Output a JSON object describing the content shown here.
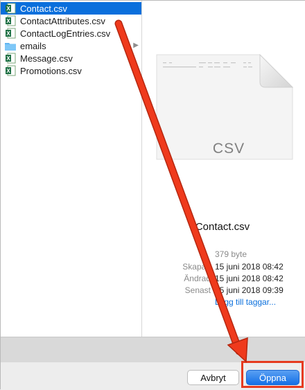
{
  "files": [
    {
      "name": "Contact.csv",
      "type": "csv",
      "selected": true
    },
    {
      "name": "ContactAttributes.csv",
      "type": "csv",
      "selected": false
    },
    {
      "name": "ContactLogEntries.csv",
      "type": "csv",
      "selected": false
    },
    {
      "name": "emails",
      "type": "folder",
      "selected": false
    },
    {
      "name": "Message.csv",
      "type": "csv",
      "selected": false
    },
    {
      "name": "Promotions.csv",
      "type": "csv",
      "selected": false
    }
  ],
  "preview": {
    "doc_label": "CSV",
    "filename": "Contact.csv",
    "size": "379 byte",
    "created_label": "Skapad",
    "created_value": "15 juni 2018 08:42",
    "modified_label": "Ändrad",
    "modified_value": "15 juni 2018 08:42",
    "opened_label": "Senast",
    "opened_value": "15 juni 2018 09:39",
    "add_tags": "Lägg till taggar..."
  },
  "buttons": {
    "cancel": "Avbryt",
    "open": "Öppna"
  },
  "colors": {
    "selection": "#0a6fdc",
    "annotation": "#e63b1f"
  }
}
